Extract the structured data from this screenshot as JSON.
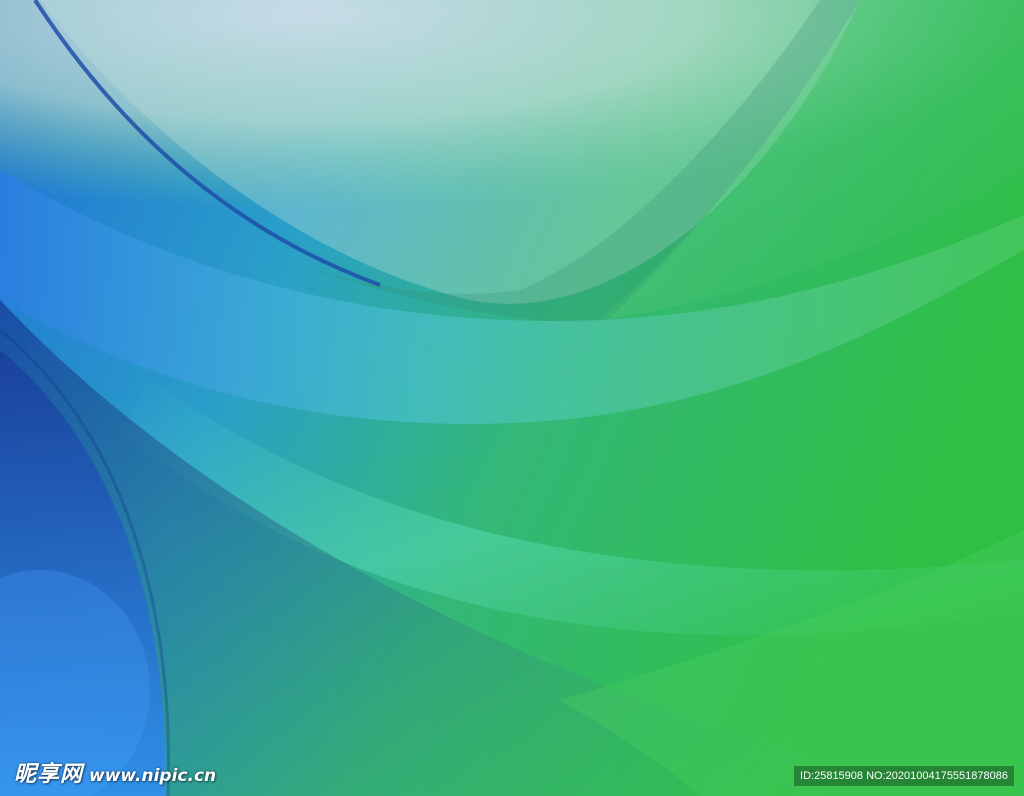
{
  "watermark": {
    "brand": "昵享网",
    "site": "www.nipic.cn",
    "id_text": "ID:25815908 NO:20201004175551878086"
  },
  "colors": {
    "deep_blue": "#1a4fb0",
    "mid_blue": "#2a8fd0",
    "teal": "#3cbcae",
    "green": "#34c24a",
    "light_wash": "#c9d8ea"
  }
}
